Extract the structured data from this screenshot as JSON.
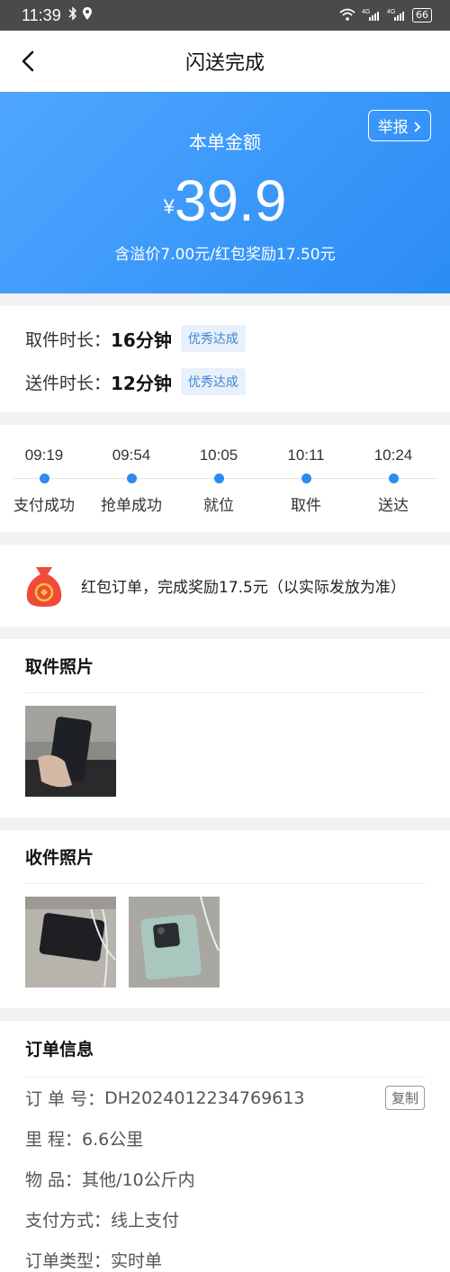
{
  "status_bar": {
    "time": "11:39",
    "battery": "66"
  },
  "nav": {
    "title": "闪送完成"
  },
  "hero": {
    "report_label": "举报",
    "label": "本单金额",
    "currency": "¥",
    "amount": "39.9",
    "breakdown": "含溢价7.00元/红包奖励17.50元"
  },
  "durations": [
    {
      "label": "取件时长：",
      "value": "16分钟",
      "tag": "优秀达成"
    },
    {
      "label": "送件时长：",
      "value": "12分钟",
      "tag": "优秀达成"
    }
  ],
  "timeline": [
    {
      "time": "09:19",
      "name": "支付成功"
    },
    {
      "time": "09:54",
      "name": "抢单成功"
    },
    {
      "time": "10:05",
      "name": "就位"
    },
    {
      "time": "10:11",
      "name": "取件"
    },
    {
      "time": "10:24",
      "name": "送达"
    }
  ],
  "redpack": {
    "text": "红包订单，完成奖励17.5元（以实际发放为准）"
  },
  "pickup_photos": {
    "title": "取件照片"
  },
  "receive_photos": {
    "title": "收件照片"
  },
  "order_info": {
    "title": "订单信息",
    "order_no_label": "订 单 号：",
    "order_no": "DH2024012234769613",
    "copy_label": "复制",
    "mileage_label": "里 程：",
    "mileage": "6.6公里",
    "item_label": "物 品：",
    "item": "其他/10公斤内",
    "pay_label": "支付方式：",
    "pay": "线上支付",
    "type_label": "订单类型：",
    "type": "实时单"
  },
  "colors": {
    "primary": "#2e8bf0",
    "tag_text": "#3d86d4",
    "red": "#f04a3a"
  }
}
